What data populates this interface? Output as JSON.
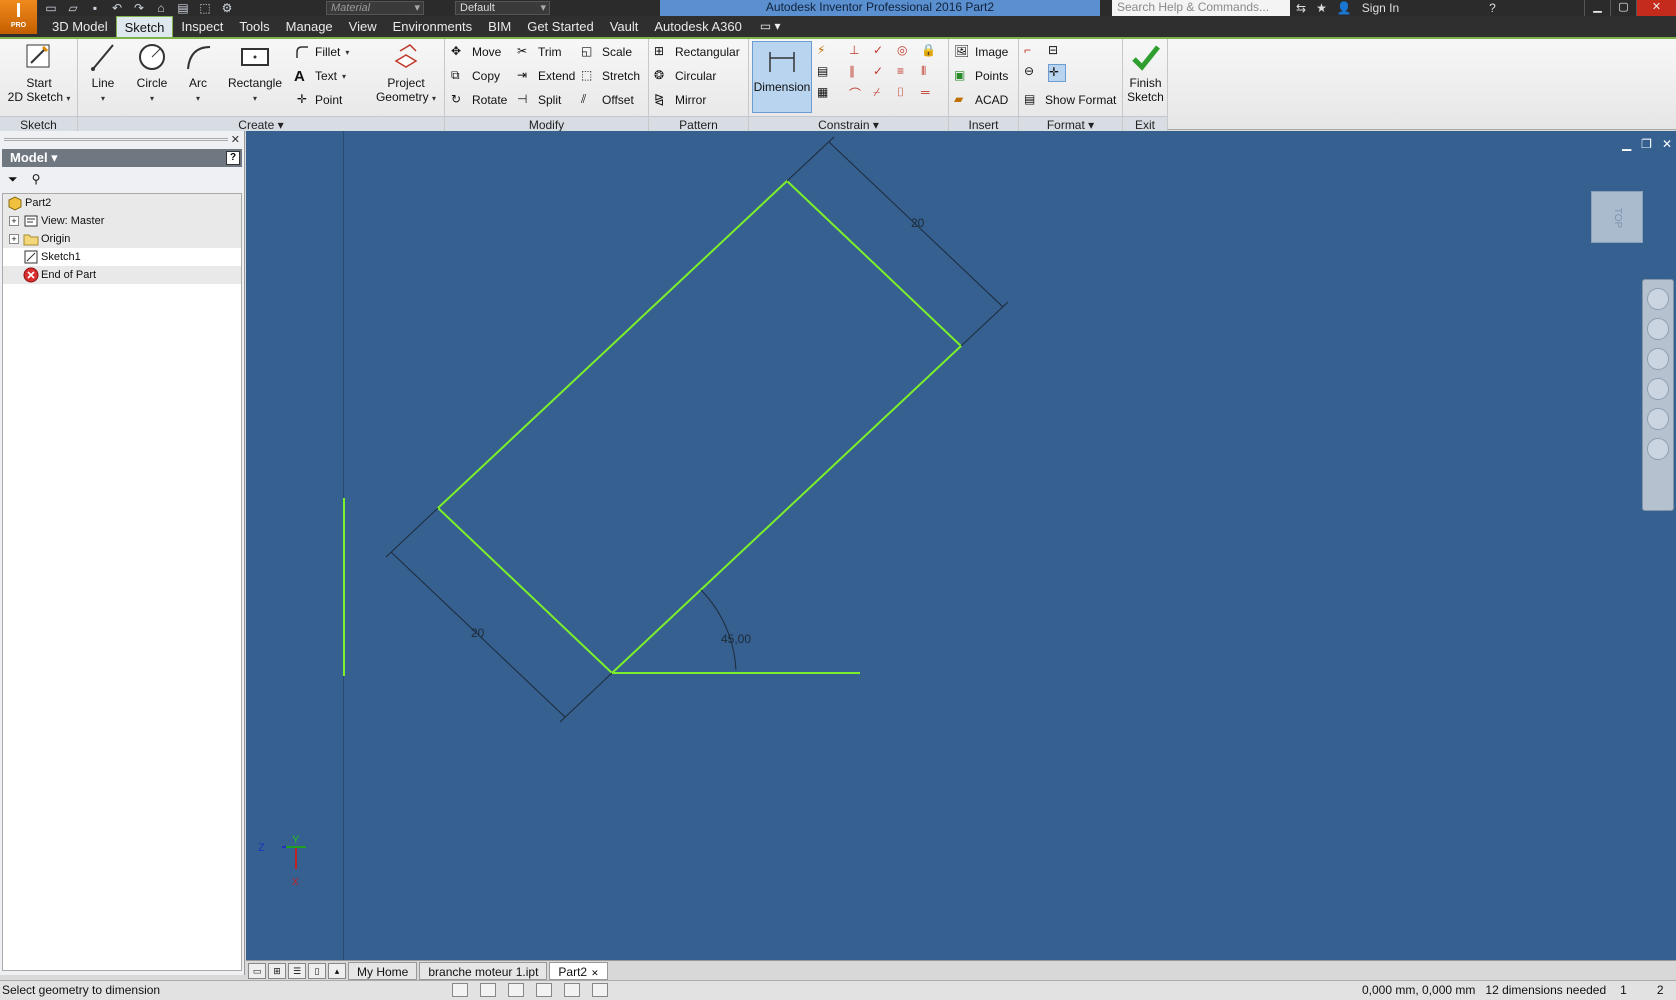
{
  "app": {
    "logo_letter": "I",
    "logo_sub": "PRO",
    "window_title": "Autodesk Inventor Professional 2016    Part2",
    "material_combo": "Material",
    "appearance_combo": "Default",
    "search_placeholder": "Search Help & Commands...",
    "sign_in": "Sign In"
  },
  "ribbon_tabs": [
    {
      "label": "3D Model"
    },
    {
      "label": "Sketch"
    },
    {
      "label": "Inspect"
    },
    {
      "label": "Tools"
    },
    {
      "label": "Manage"
    },
    {
      "label": "View"
    },
    {
      "label": "Environments"
    },
    {
      "label": "BIM"
    },
    {
      "label": "Get Started"
    },
    {
      "label": "Vault"
    },
    {
      "label": "Autodesk A360"
    }
  ],
  "ribbon": {
    "sketch_panel": {
      "label": "Sketch",
      "start_line1": "Start",
      "start_line2": "2D Sketch"
    },
    "create_panel": {
      "label": "Create",
      "line": "Line",
      "circle": "Circle",
      "arc": "Arc",
      "rectangle": "Rectangle",
      "fillet": "Fillet",
      "text": "Text",
      "point": "Point",
      "project_line1": "Project",
      "project_line2": "Geometry"
    },
    "modify_panel": {
      "label": "Modify",
      "move": "Move",
      "copy": "Copy",
      "rotate": "Rotate",
      "trim": "Trim",
      "extend": "Extend",
      "split": "Split",
      "scale": "Scale",
      "stretch": "Stretch",
      "offset": "Offset"
    },
    "pattern_panel": {
      "label": "Pattern",
      "rectangular": "Rectangular",
      "circular": "Circular",
      "mirror": "Mirror"
    },
    "constrain_panel": {
      "label": "Constrain",
      "dimension": "Dimension"
    },
    "insert_panel": {
      "label": "Insert",
      "image": "Image",
      "points": "Points",
      "acad": "ACAD"
    },
    "format_panel": {
      "label": "Format",
      "show_format": "Show Format"
    },
    "exit_panel": {
      "label": "Exit",
      "finish_line1": "Finish",
      "finish_line2": "Sketch"
    }
  },
  "browser": {
    "title": "Model",
    "help": "?",
    "tree": [
      {
        "label": "Part2",
        "icon": "part-icon"
      },
      {
        "label": "View: Master",
        "icon": "view-icon"
      },
      {
        "label": "Origin",
        "icon": "folder-icon"
      },
      {
        "label": "Sketch1",
        "icon": "sketch-icon"
      },
      {
        "label": "End of Part",
        "icon": "end-of-part-icon"
      }
    ]
  },
  "sketch": {
    "dim_top": "20",
    "dim_left": "20",
    "dim_angle": "45,00",
    "line_color": "#7cf02a",
    "background": "#35608f"
  },
  "viewcube": {
    "face": "TOP"
  },
  "doc_tabs": [
    {
      "label": "My Home"
    },
    {
      "label": "branche moteur 1.ipt"
    },
    {
      "label": "Part2"
    }
  ],
  "status": {
    "message": "Select geometry to dimension",
    "coords": "0,000 mm, 0,000 mm",
    "dims_needed": "12 dimensions needed",
    "count1": "1",
    "count2": "2"
  }
}
